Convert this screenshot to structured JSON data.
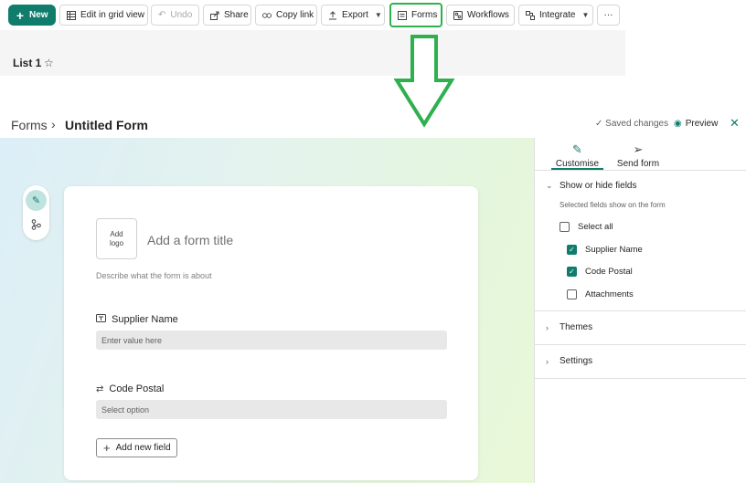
{
  "toolbar": {
    "new_label": "New",
    "edit_grid_label": "Edit in grid view",
    "undo_label": "Undo",
    "share_label": "Share",
    "copy_link_label": "Copy link",
    "export_label": "Export",
    "forms_label": "Forms",
    "workflows_label": "Workflows",
    "integrate_label": "Integrate",
    "more_label": "···"
  },
  "list": {
    "title": "List 1"
  },
  "forms_header": {
    "breadcrumb_root": "Forms",
    "breadcrumb_current": "Untitled Form",
    "saved_status": "Saved changes",
    "preview_label": "Preview"
  },
  "form": {
    "logo_placeholder_line1": "Add",
    "logo_placeholder_line2": "logo",
    "title_placeholder": "Add a form title",
    "description_placeholder": "Describe what the form is about",
    "questions": [
      {
        "label": "Supplier Name",
        "placeholder": "Enter value here"
      },
      {
        "label": "Code Postal",
        "placeholder": "Select option"
      }
    ],
    "add_field_label": "Add new field"
  },
  "panel": {
    "tabs": [
      {
        "label": "Customise"
      },
      {
        "label": "Send form"
      }
    ],
    "show_hide": {
      "heading": "Show or hide fields",
      "subtitle": "Selected fields show on the form",
      "select_all": "Select all",
      "fields": [
        {
          "label": "Supplier Name",
          "checked": true
        },
        {
          "label": "Code Postal",
          "checked": true
        },
        {
          "label": "Attachments",
          "checked": false
        }
      ]
    },
    "themes_label": "Themes",
    "settings_label": "Settings"
  },
  "colors": {
    "accent": "#0f7c6c",
    "highlight": "#2fb04f"
  }
}
